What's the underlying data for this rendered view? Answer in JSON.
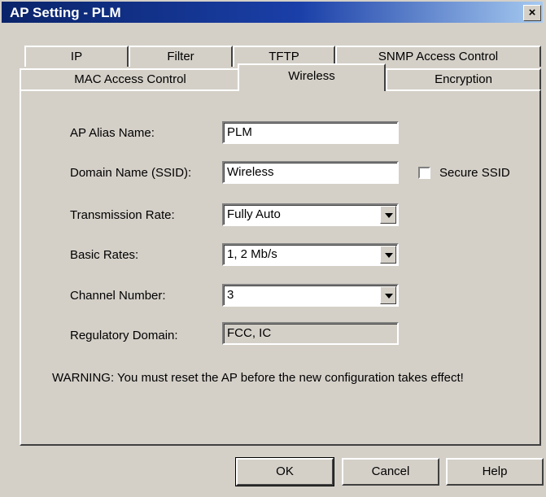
{
  "window": {
    "title": "AP Setting - PLM",
    "close_label": "×"
  },
  "tabs_back": [
    {
      "label": "IP"
    },
    {
      "label": "Filter"
    },
    {
      "label": "TFTP"
    },
    {
      "label": "SNMP Access Control"
    }
  ],
  "tabs_front": [
    {
      "label": "MAC Access Control"
    },
    {
      "label": "Wireless",
      "active": true
    },
    {
      "label": "Encryption"
    }
  ],
  "form": {
    "alias_label": "AP Alias Name:",
    "alias_value": "PLM",
    "ssid_label": "Domain Name (SSID):",
    "ssid_value": "Wireless",
    "secure_ssid_label": "Secure SSID",
    "secure_ssid_checked": false,
    "tx_rate_label": "Transmission Rate:",
    "tx_rate_value": "Fully Auto",
    "basic_rates_label": "Basic Rates:",
    "basic_rates_value": "1, 2 Mb/s",
    "channel_label": "Channel Number:",
    "channel_value": "3",
    "reg_domain_label": "Regulatory Domain:",
    "reg_domain_value": "FCC, IC"
  },
  "warning": "WARNING: You must reset the AP before the new configuration takes effect!",
  "buttons": {
    "ok": "OK",
    "cancel": "Cancel",
    "help": "Help"
  }
}
